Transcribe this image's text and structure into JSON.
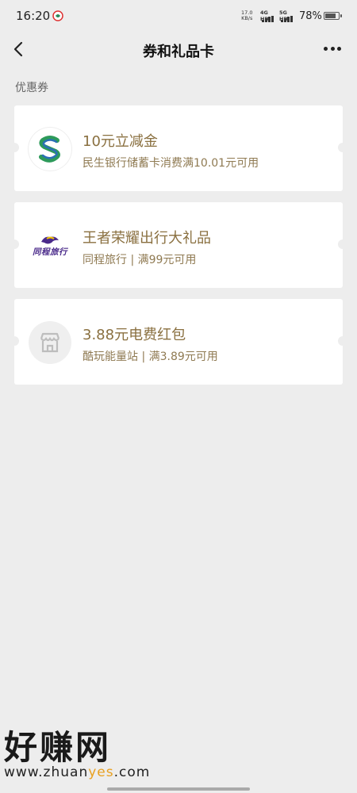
{
  "status_bar": {
    "time": "16:20",
    "net_speed_value": "17.0",
    "net_speed_unit": "KB/s",
    "signal_1": "4G HD",
    "signal_2": "5G HD",
    "battery": "78%"
  },
  "nav": {
    "title": "券和礼品卡"
  },
  "section": {
    "title": "优惠券"
  },
  "coupons": [
    {
      "title": "10元立减金",
      "subtitle": "民生银行储蓄卡消费满10.01元可用",
      "logo": "minsheng-bank-logo"
    },
    {
      "title": "王者荣耀出行大礼品",
      "subtitle": "同程旅行 | 满99元可用",
      "logo": "tongcheng-travel-logo",
      "logo_text": "同程旅行"
    },
    {
      "title": "3.88元电费红包",
      "subtitle": "酷玩能量站 | 满3.89元可用",
      "logo": "store-icon"
    }
  ],
  "watermark": {
    "big": "好赚网",
    "small_pre": "www.zhuan",
    "small_hl": "yes",
    "small_post": ".com"
  },
  "colors": {
    "background": "#ededed",
    "card": "#ffffff",
    "coupon_title": "#8a7040",
    "coupon_subtitle": "#8f7a52"
  }
}
